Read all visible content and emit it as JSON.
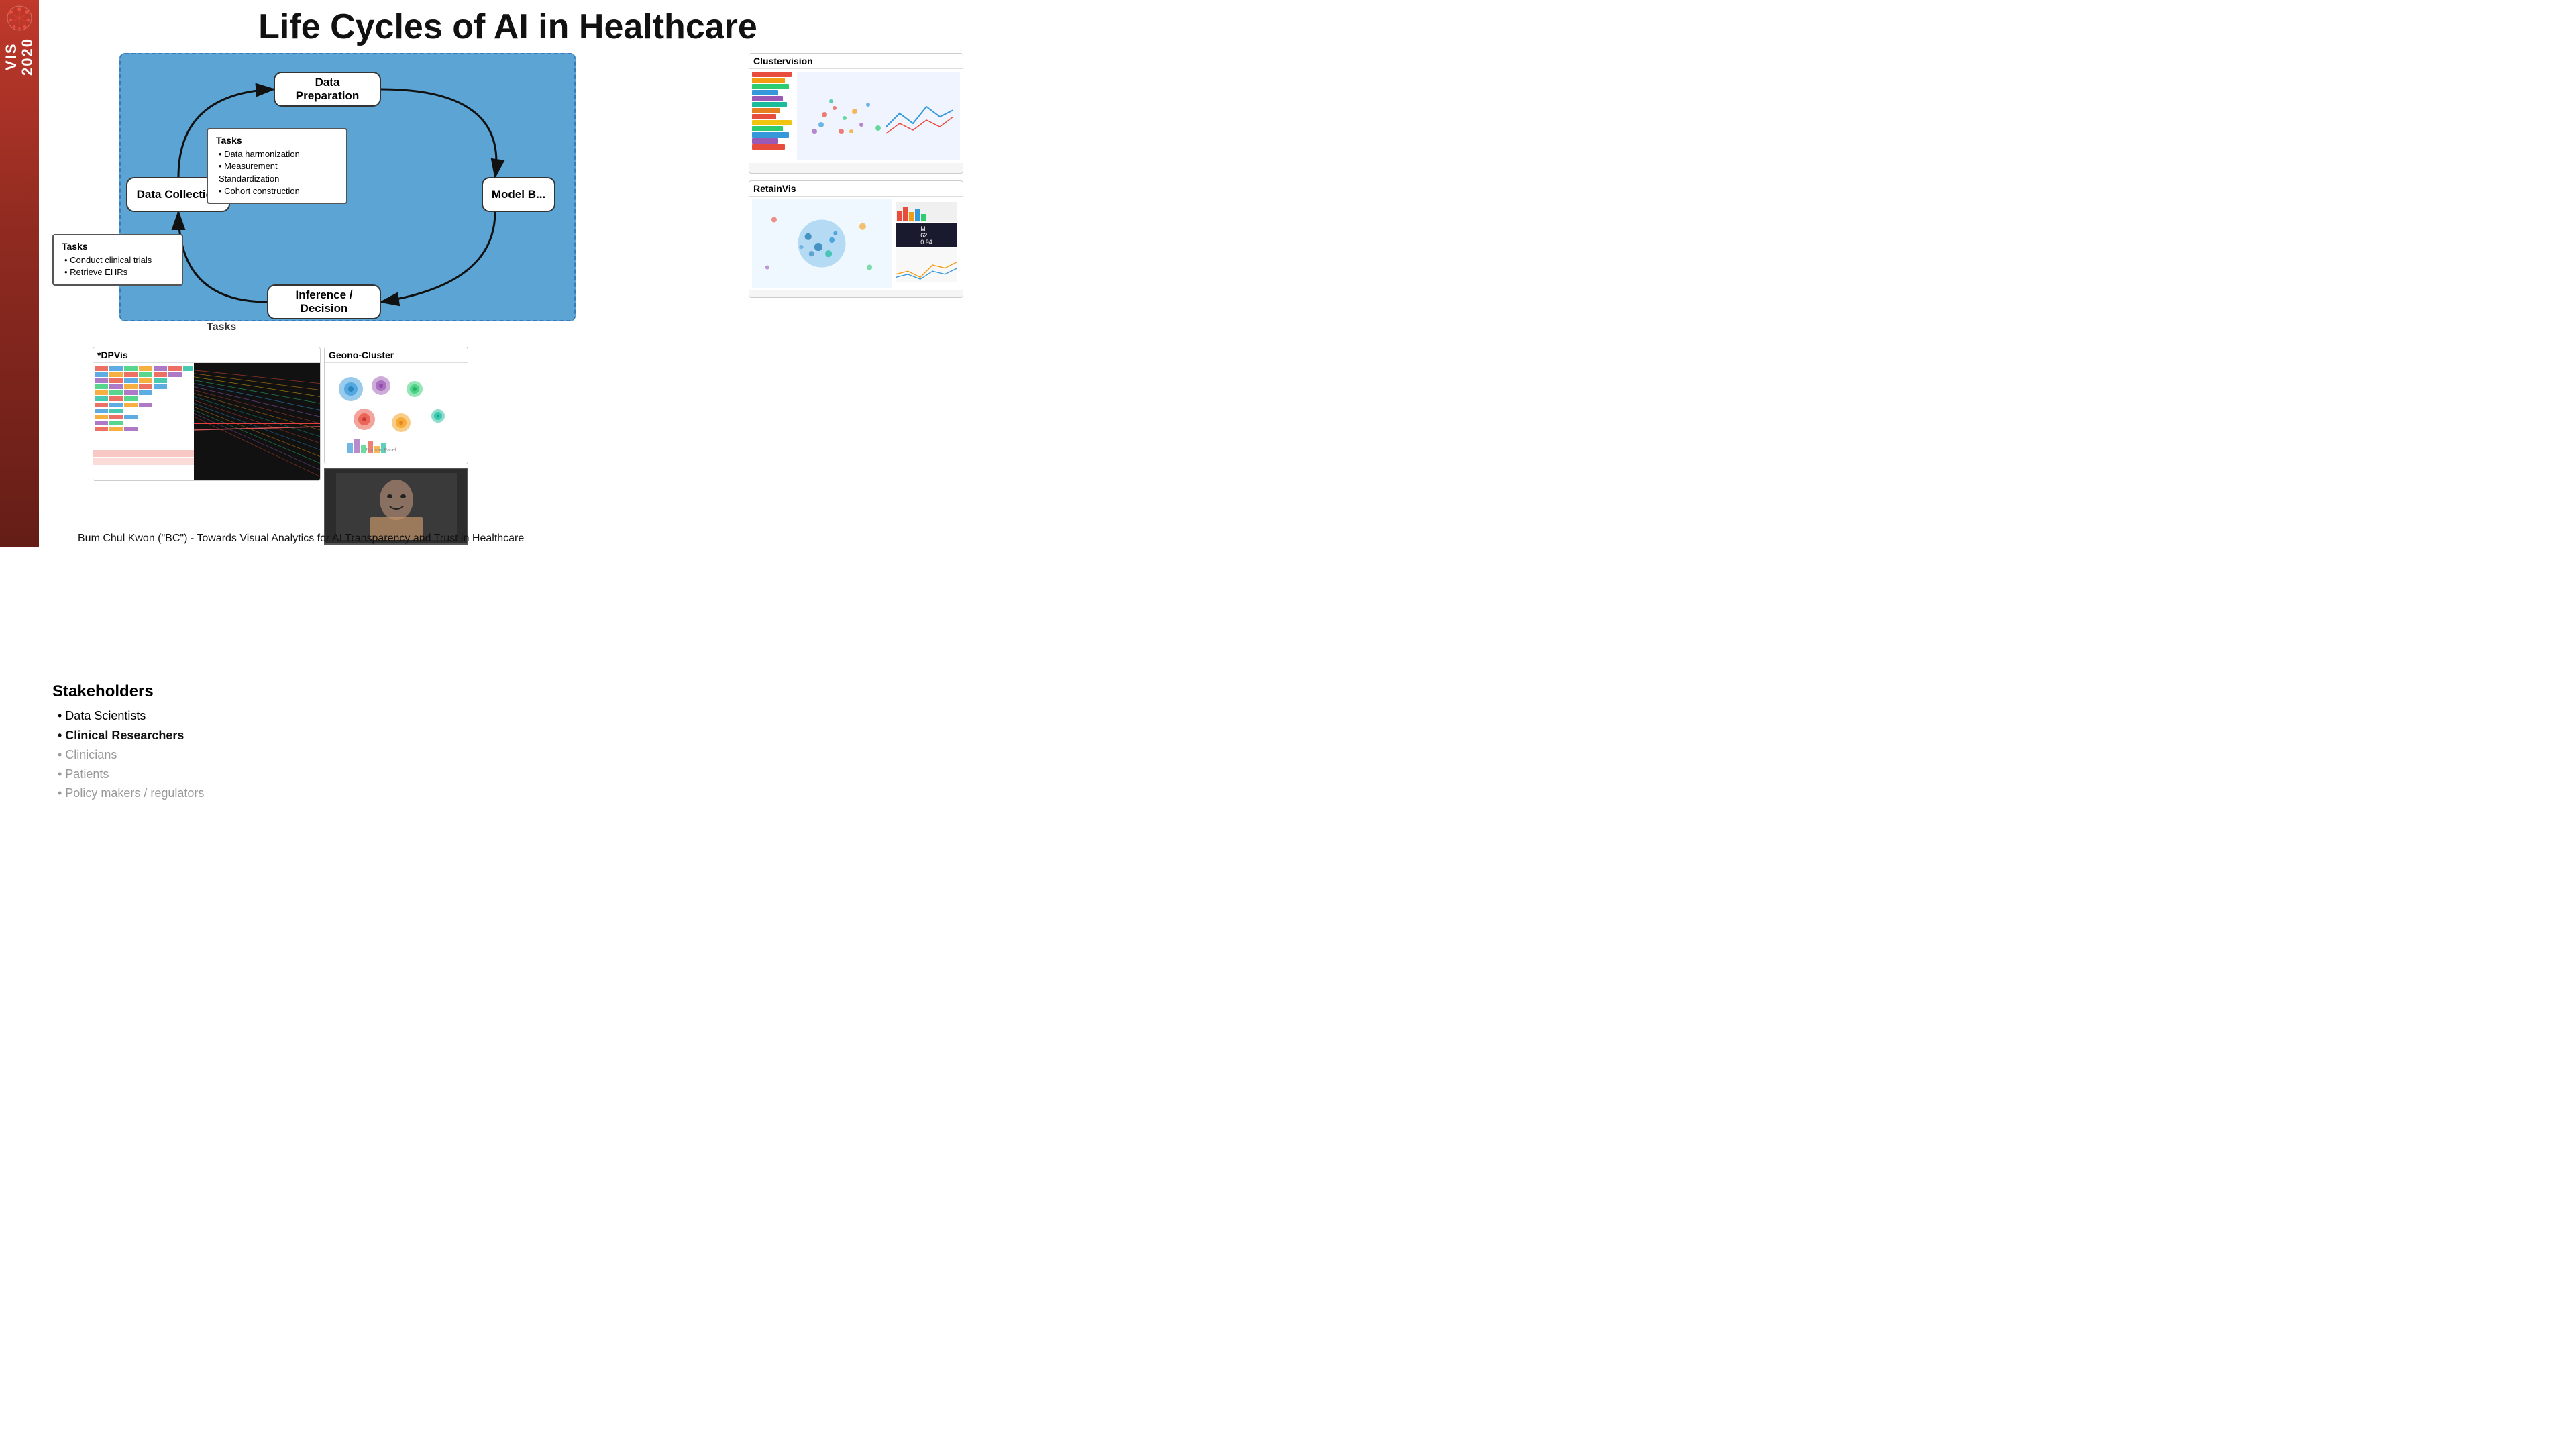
{
  "sidebar": {
    "logo_text": "VIS",
    "year": "2020"
  },
  "title": "Life Cycles of AI in Healthcare",
  "diagram": {
    "boxes": {
      "data_preparation": "Data Preparation",
      "data_collection": "Data Collection",
      "model_building": "Model B...",
      "inference_decision": "Inference / Decision"
    },
    "tasks_center": {
      "title": "Tasks",
      "items": [
        "• Data harmonization",
        "• Measurement Standardization",
        "• Cohort construction"
      ]
    },
    "tasks_left": {
      "title": "Tasks",
      "items": [
        "• Conduct clinical trials",
        "• Retrieve EHRs"
      ]
    }
  },
  "stakeholders": {
    "title": "Stakeholders",
    "items": [
      {
        "label": "• Data Scientists",
        "style": "normal"
      },
      {
        "label": "• Clinical Researchers",
        "style": "bold"
      },
      {
        "label": "• Clinicians",
        "style": "dimmed"
      },
      {
        "label": "• Patients",
        "style": "dimmed"
      },
      {
        "label": "• Policy makers / regulators",
        "style": "dimmed"
      }
    ]
  },
  "tools": [
    {
      "name": "Clustervision",
      "id": "clustervision"
    },
    {
      "name": "RetainVis",
      "id": "retainvis"
    },
    {
      "name": "*DPVis",
      "id": "dpvis"
    },
    {
      "name": "Geono-Cluster",
      "id": "geonocluster"
    }
  ],
  "bottom_caption": "Bum Chul Kwon (\"BC\") - Towards Visual Analytics for AI Transparency and Trust in Healthcare"
}
